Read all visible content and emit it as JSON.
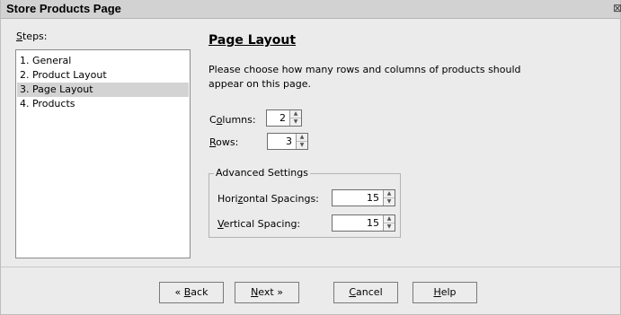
{
  "window": {
    "title": "Store Products Page"
  },
  "steps": {
    "label_mnemonic": "S",
    "label_rest": "teps:",
    "items": [
      {
        "label": "1. General"
      },
      {
        "label": "2. Product Layout"
      },
      {
        "label": "3. Page Layout"
      },
      {
        "label": "4. Products"
      }
    ],
    "selected_index": 2
  },
  "page": {
    "title": "Page Layout",
    "description_line1": "Please choose how many rows and columns of products should",
    "description_line2": "appear on this page."
  },
  "fields": {
    "columns": {
      "label_pre": "C",
      "label_mn": "o",
      "label_post": "lumns:",
      "value": "2"
    },
    "rows": {
      "label_pre": "",
      "label_mn": "R",
      "label_post": "ows:",
      "value": "3"
    }
  },
  "advanced": {
    "legend": "Advanced Settings",
    "horizontal": {
      "label_pre": "Hori",
      "label_mn": "z",
      "label_post": "ontal Spacings:",
      "value": "15"
    },
    "vertical": {
      "label_pre": "",
      "label_mn": "V",
      "label_post": "ertical Spacing:",
      "value": "15"
    }
  },
  "buttons": {
    "back": {
      "arrow": "«",
      "mn": "B",
      "rest": "ack"
    },
    "next": {
      "mn": "N",
      "rest": "ext",
      "arrow": "»"
    },
    "cancel": {
      "mn": "C",
      "rest": "ancel"
    },
    "help": {
      "mn": "H",
      "rest": "elp"
    }
  },
  "icons": {
    "close": "close-icon",
    "spin_up": "spin-up-icon",
    "spin_down": "spin-down-icon"
  },
  "colors": {
    "dialog_bg": "#ebebeb",
    "titlebar_bg": "#d2d2d2",
    "selected_row": "#d3d3d3"
  }
}
